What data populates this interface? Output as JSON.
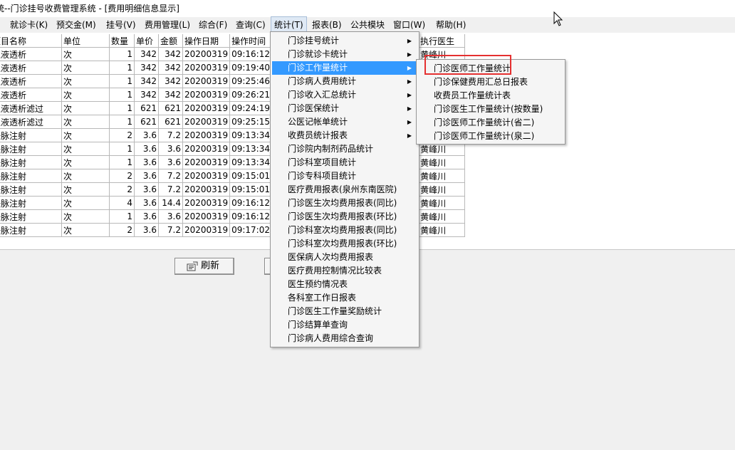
{
  "window": {
    "title": "统--门诊挂号收费管理系统 - [费用明细信息显示]"
  },
  "menubar": {
    "items": [
      {
        "label": "就诊卡(K)"
      },
      {
        "label": "预交金(M)"
      },
      {
        "label": "挂号(V)"
      },
      {
        "label": "费用管理(L)"
      },
      {
        "label": "综合(F)"
      },
      {
        "label": "查询(C)"
      },
      {
        "label": "统计(T)"
      },
      {
        "label": "报表(B)"
      },
      {
        "label": "公共模块"
      },
      {
        "label": "窗口(W)"
      },
      {
        "label": "帮助(H)"
      }
    ]
  },
  "table": {
    "headers": [
      "项目名称",
      "单位",
      "数量",
      "单价",
      "金额",
      "操作日期",
      "操作时间",
      "执行医生"
    ],
    "rows": [
      [
        "血液透析",
        "次",
        "1",
        "342",
        "342",
        "20200319",
        "09:16:12",
        "黄峰川"
      ],
      [
        "血液透析",
        "次",
        "1",
        "342",
        "342",
        "20200319",
        "09:19:40",
        ""
      ],
      [
        "血液透析",
        "次",
        "1",
        "342",
        "342",
        "20200319",
        "09:25:46",
        ""
      ],
      [
        "血液透析",
        "次",
        "1",
        "342",
        "342",
        "20200319",
        "09:26:21",
        ""
      ],
      [
        "血液透析滤过",
        "次",
        "1",
        "621",
        "621",
        "20200319",
        "09:24:19",
        ""
      ],
      [
        "血液透析滤过",
        "次",
        "1",
        "621",
        "621",
        "20200319",
        "09:25:15",
        ""
      ],
      [
        "静脉注射",
        "次",
        "2",
        "3.6",
        "7.2",
        "20200319",
        "09:13:34",
        ""
      ],
      [
        "静脉注射",
        "次",
        "1",
        "3.6",
        "3.6",
        "20200319",
        "09:13:34",
        "黄峰川"
      ],
      [
        "静脉注射",
        "次",
        "1",
        "3.6",
        "3.6",
        "20200319",
        "09:13:34",
        "黄峰川"
      ],
      [
        "静脉注射",
        "次",
        "2",
        "3.6",
        "7.2",
        "20200319",
        "09:15:01",
        "黄峰川"
      ],
      [
        "静脉注射",
        "次",
        "2",
        "3.6",
        "7.2",
        "20200319",
        "09:15:01",
        "黄峰川"
      ],
      [
        "静脉注射",
        "次",
        "4",
        "3.6",
        "14.4",
        "20200319",
        "09:16:12",
        "黄峰川"
      ],
      [
        "静脉注射",
        "次",
        "1",
        "3.6",
        "3.6",
        "20200319",
        "09:16:12",
        "黄峰川"
      ],
      [
        "静脉注射",
        "次",
        "2",
        "3.6",
        "7.2",
        "20200319",
        "09:17:02",
        "黄峰川"
      ]
    ]
  },
  "buttons": {
    "refresh": "刷新"
  },
  "stats_menu": {
    "items": [
      {
        "label": "门诊挂号统计",
        "submenu": true
      },
      {
        "label": "门诊就诊卡统计",
        "submenu": true
      },
      {
        "label": "门诊工作量统计",
        "submenu": true
      },
      {
        "label": "门诊病人费用统计",
        "submenu": true
      },
      {
        "label": "门诊收入汇总统计",
        "submenu": true
      },
      {
        "label": "门诊医保统计",
        "submenu": true
      },
      {
        "label": "公医记帐单统计",
        "submenu": true
      },
      {
        "label": "收费员统计报表",
        "submenu": true
      },
      {
        "label": "门诊院内制剂药品统计",
        "submenu": false
      },
      {
        "label": "门诊科室项目统计",
        "submenu": false
      },
      {
        "label": "门诊专科项目统计",
        "submenu": false
      },
      {
        "label": "医疗费用报表(泉州东南医院)",
        "submenu": false
      },
      {
        "label": "门诊医生次均费用报表(同比)",
        "submenu": false
      },
      {
        "label": "门诊医生次均费用报表(环比)",
        "submenu": false
      },
      {
        "label": "门诊科室次均费用报表(同比)",
        "submenu": false
      },
      {
        "label": "门诊科室次均费用报表(环比)",
        "submenu": false
      },
      {
        "label": "医保病人次均费用报表",
        "submenu": false
      },
      {
        "label": "医疗费用控制情况比较表",
        "submenu": false
      },
      {
        "label": "医生预约情况表",
        "submenu": false
      },
      {
        "label": "各科室工作日报表",
        "submenu": false
      },
      {
        "label": "门诊医生工作量奖励统计",
        "submenu": false
      },
      {
        "label": "门诊结算单查询",
        "submenu": false
      },
      {
        "label": "门诊病人费用综合查询",
        "submenu": false
      }
    ]
  },
  "workload_submenu": {
    "items": [
      {
        "label": "门诊医师工作量统计"
      },
      {
        "label": "门诊保健费用汇总日报表"
      },
      {
        "label": "收费员工作量统计表"
      },
      {
        "label": "门诊医生工作量统计(按数量)"
      },
      {
        "label": "门诊医师工作量统计(省二)"
      },
      {
        "label": "门诊医师工作量统计(泉二)"
      }
    ]
  },
  "colors": {
    "highlight": "#3399ff",
    "annotation": "#e53030"
  }
}
